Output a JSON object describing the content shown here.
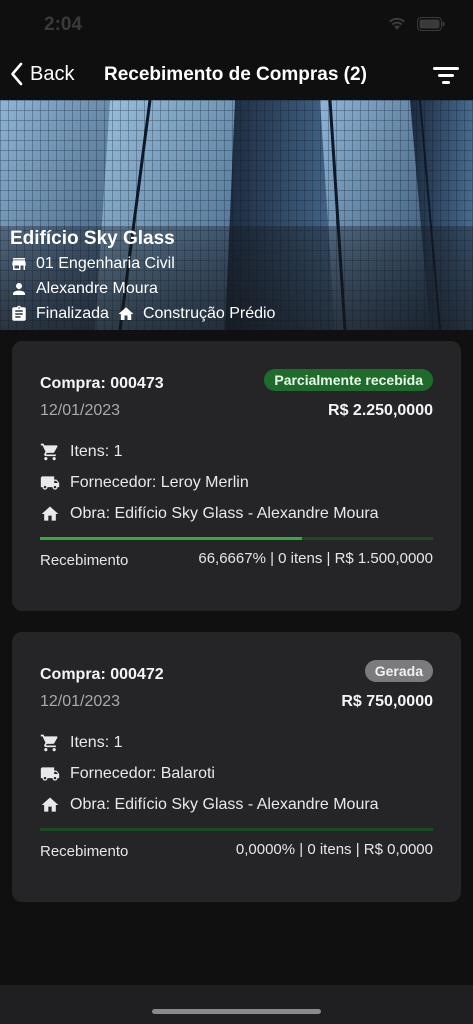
{
  "status_bar": {
    "time": "2:04"
  },
  "nav": {
    "back_label": "Back",
    "title": "Recebimento de Compras (2)"
  },
  "hero": {
    "title": "Edifício Sky Glass",
    "company": "01 Engenharia Civil",
    "person": "Alexandre Moura",
    "status": "Finalizada",
    "project_type": "Construção Prédio"
  },
  "purchases": [
    {
      "title": "Compra: 000473",
      "status": "Parcialmente recebida",
      "status_color": "#1f6b2c",
      "date": "12/01/2023",
      "amount": "R$ 2.250,0000",
      "items": "Itens: 1",
      "supplier": "Fornecedor: Leroy Merlin",
      "site": "Obra: Edifício Sky Glass - Alexandre Moura",
      "receipt_label": "Recebimento",
      "receipt_value": "66,6667% | 0 itens | R$ 1.500,0000",
      "receipt_progress": 0.666667
    },
    {
      "title": "Compra: 000472",
      "status": "Gerada",
      "status_color": "#7b7b7f",
      "date": "12/01/2023",
      "amount": "R$ 750,0000",
      "items": "Itens: 1",
      "supplier": "Fornecedor: Balaroti",
      "site": "Obra: Edifício Sky Glass - Alexandre Moura",
      "receipt_label": "Recebimento",
      "receipt_value": "0,0000% | 0 itens | R$ 0,0000",
      "receipt_progress": 0
    }
  ],
  "colors": {
    "background": "#101011",
    "card": "#252528",
    "progress_fill": "#2fae3f",
    "progress_track": "#1b4d24"
  }
}
